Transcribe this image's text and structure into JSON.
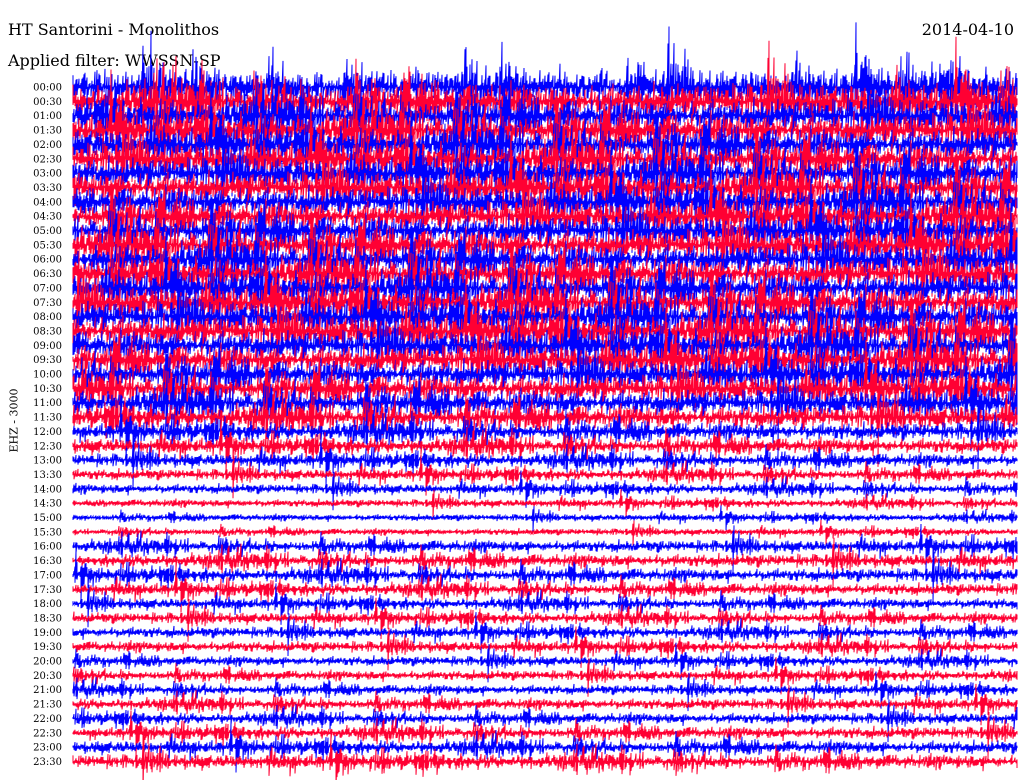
{
  "header": {
    "station": "HT Santorini - Monolithos",
    "date": "2014-04-10",
    "filter_label": "Applied filter:",
    "filter_name": "WWSSN-SP"
  },
  "channel": "EHZ - 3000",
  "chart_data": {
    "type": "helicorder",
    "title": "HT Santorini - Monolithos",
    "date": "2014-04-10",
    "filter": "WWSSN-SP",
    "ylabel": "EHZ - 3000",
    "rows": [
      "00:00",
      "00:30",
      "01:00",
      "01:30",
      "02:00",
      "02:30",
      "03:00",
      "03:30",
      "04:00",
      "04:30",
      "05:00",
      "05:30",
      "06:00",
      "06:30",
      "07:00",
      "07:30",
      "08:00",
      "08:30",
      "09:00",
      "09:30",
      "10:00",
      "10:30",
      "11:00",
      "11:30",
      "12:00",
      "12:30",
      "13:00",
      "13:30",
      "14:00",
      "14:30",
      "15:00",
      "15:30",
      "16:00",
      "16:30",
      "17:00",
      "17:30",
      "18:00",
      "18:30",
      "19:00",
      "19:30",
      "20:00",
      "20:30",
      "21:00",
      "21:30",
      "22:00",
      "22:30",
      "23:00",
      "23:30"
    ],
    "trace_colors": [
      "#0000ff",
      "#ff0033"
    ],
    "relative_amplitude": [
      3.2,
      3.2,
      3.0,
      3.0,
      2.9,
      2.8,
      2.8,
      2.8,
      2.7,
      2.7,
      2.7,
      2.8,
      2.8,
      2.8,
      2.8,
      2.8,
      2.8,
      2.8,
      2.7,
      2.6,
      2.5,
      2.4,
      2.3,
      2.1,
      1.6,
      1.4,
      1.2,
      1.0,
      0.9,
      0.7,
      0.6,
      0.6,
      1.1,
      1.2,
      1.2,
      1.1,
      1.0,
      1.0,
      1.0,
      1.0,
      0.9,
      0.9,
      0.9,
      1.0,
      1.0,
      1.1,
      1.2,
      1.3
    ]
  }
}
